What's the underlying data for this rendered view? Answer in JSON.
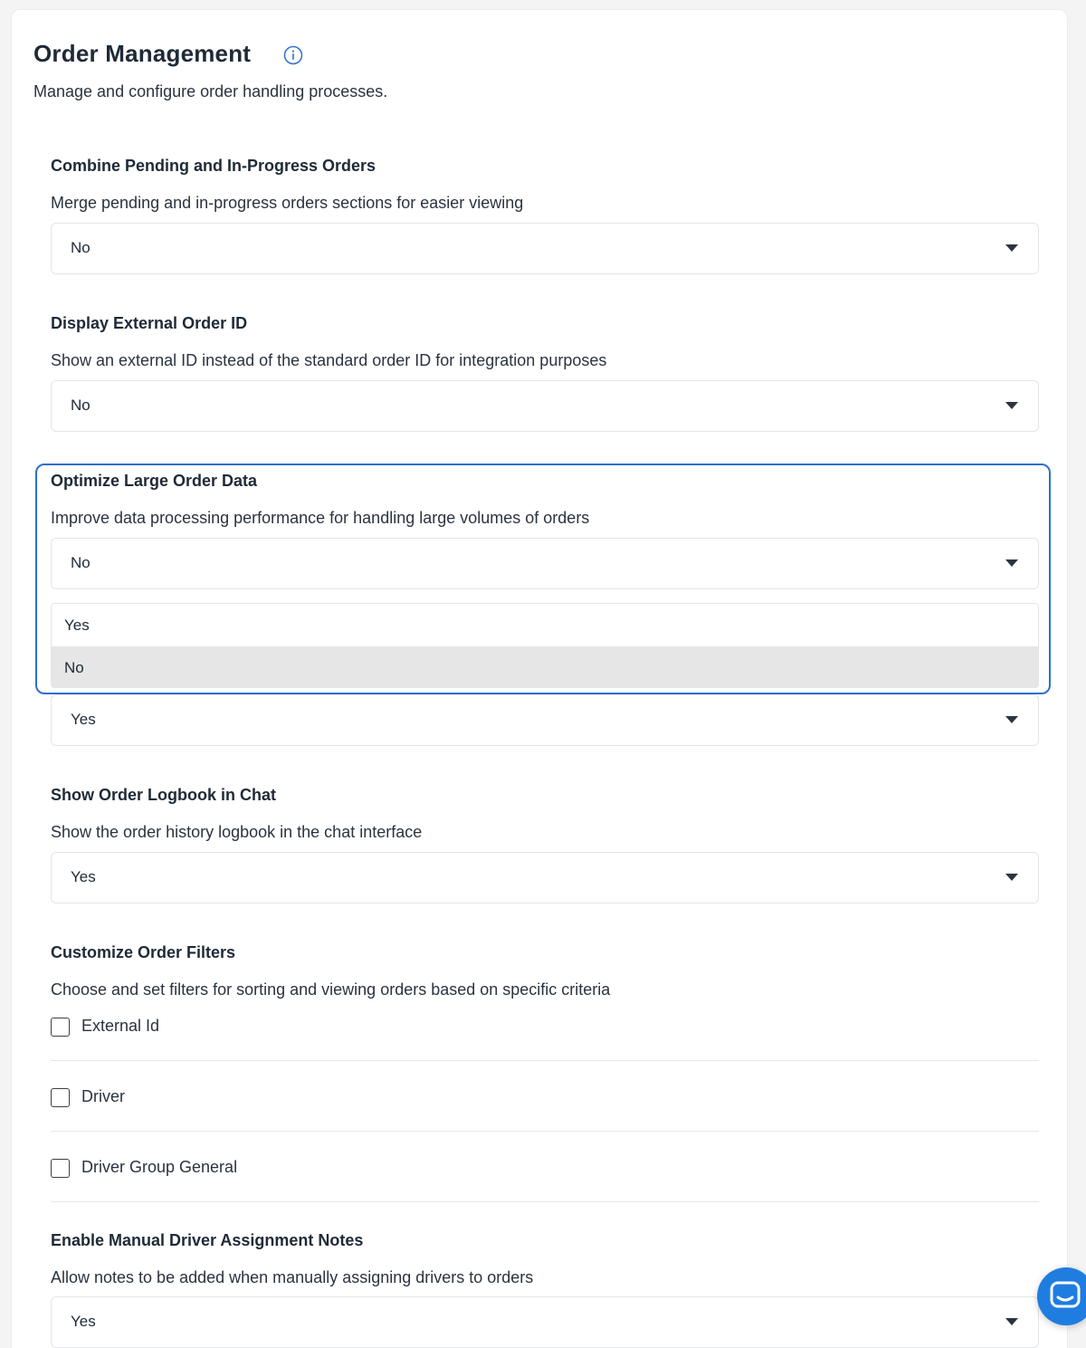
{
  "header": {
    "title": "Order Management",
    "subtitle": "Manage and configure order handling processes."
  },
  "settings": [
    {
      "title": "Combine Pending and In-Progress Orders",
      "description": "Merge pending and in-progress orders sections for easier viewing",
      "value": "No"
    },
    {
      "title": "Display External Order ID",
      "description": "Show an external ID instead of the standard order ID for integration purposes",
      "value": "No"
    },
    {
      "title": "Optimize Large Order Data",
      "description": "Improve data processing performance for handling large volumes of orders",
      "value": "No",
      "dropdown_open": true,
      "options": [
        "Yes",
        "No"
      ],
      "highlighted_option": "No"
    },
    {
      "value": "Yes"
    },
    {
      "title": "Show Order Logbook in Chat",
      "description": "Show the order history logbook in the chat interface",
      "value": "Yes"
    }
  ],
  "filters": {
    "title": "Customize Order Filters",
    "description": "Choose and set filters for sorting and viewing orders based on specific criteria",
    "options": [
      {
        "label": "External Id",
        "checked": false
      },
      {
        "label": "Driver",
        "checked": false
      },
      {
        "label": "Driver Group General",
        "checked": false
      }
    ]
  },
  "driver_notes": {
    "title": "Enable Manual Driver Assignment Notes",
    "description": "Allow notes to be added when manually assigning drivers to orders",
    "value": "Yes"
  },
  "icons": {
    "info": "info-icon",
    "caret": "caret-down-icon",
    "chat": "chat-bubble-icon"
  },
  "colors": {
    "accent": "#2f6fd1",
    "chat_launcher": "#1f7de0",
    "selected_option_bg": "#e6e6e6"
  }
}
